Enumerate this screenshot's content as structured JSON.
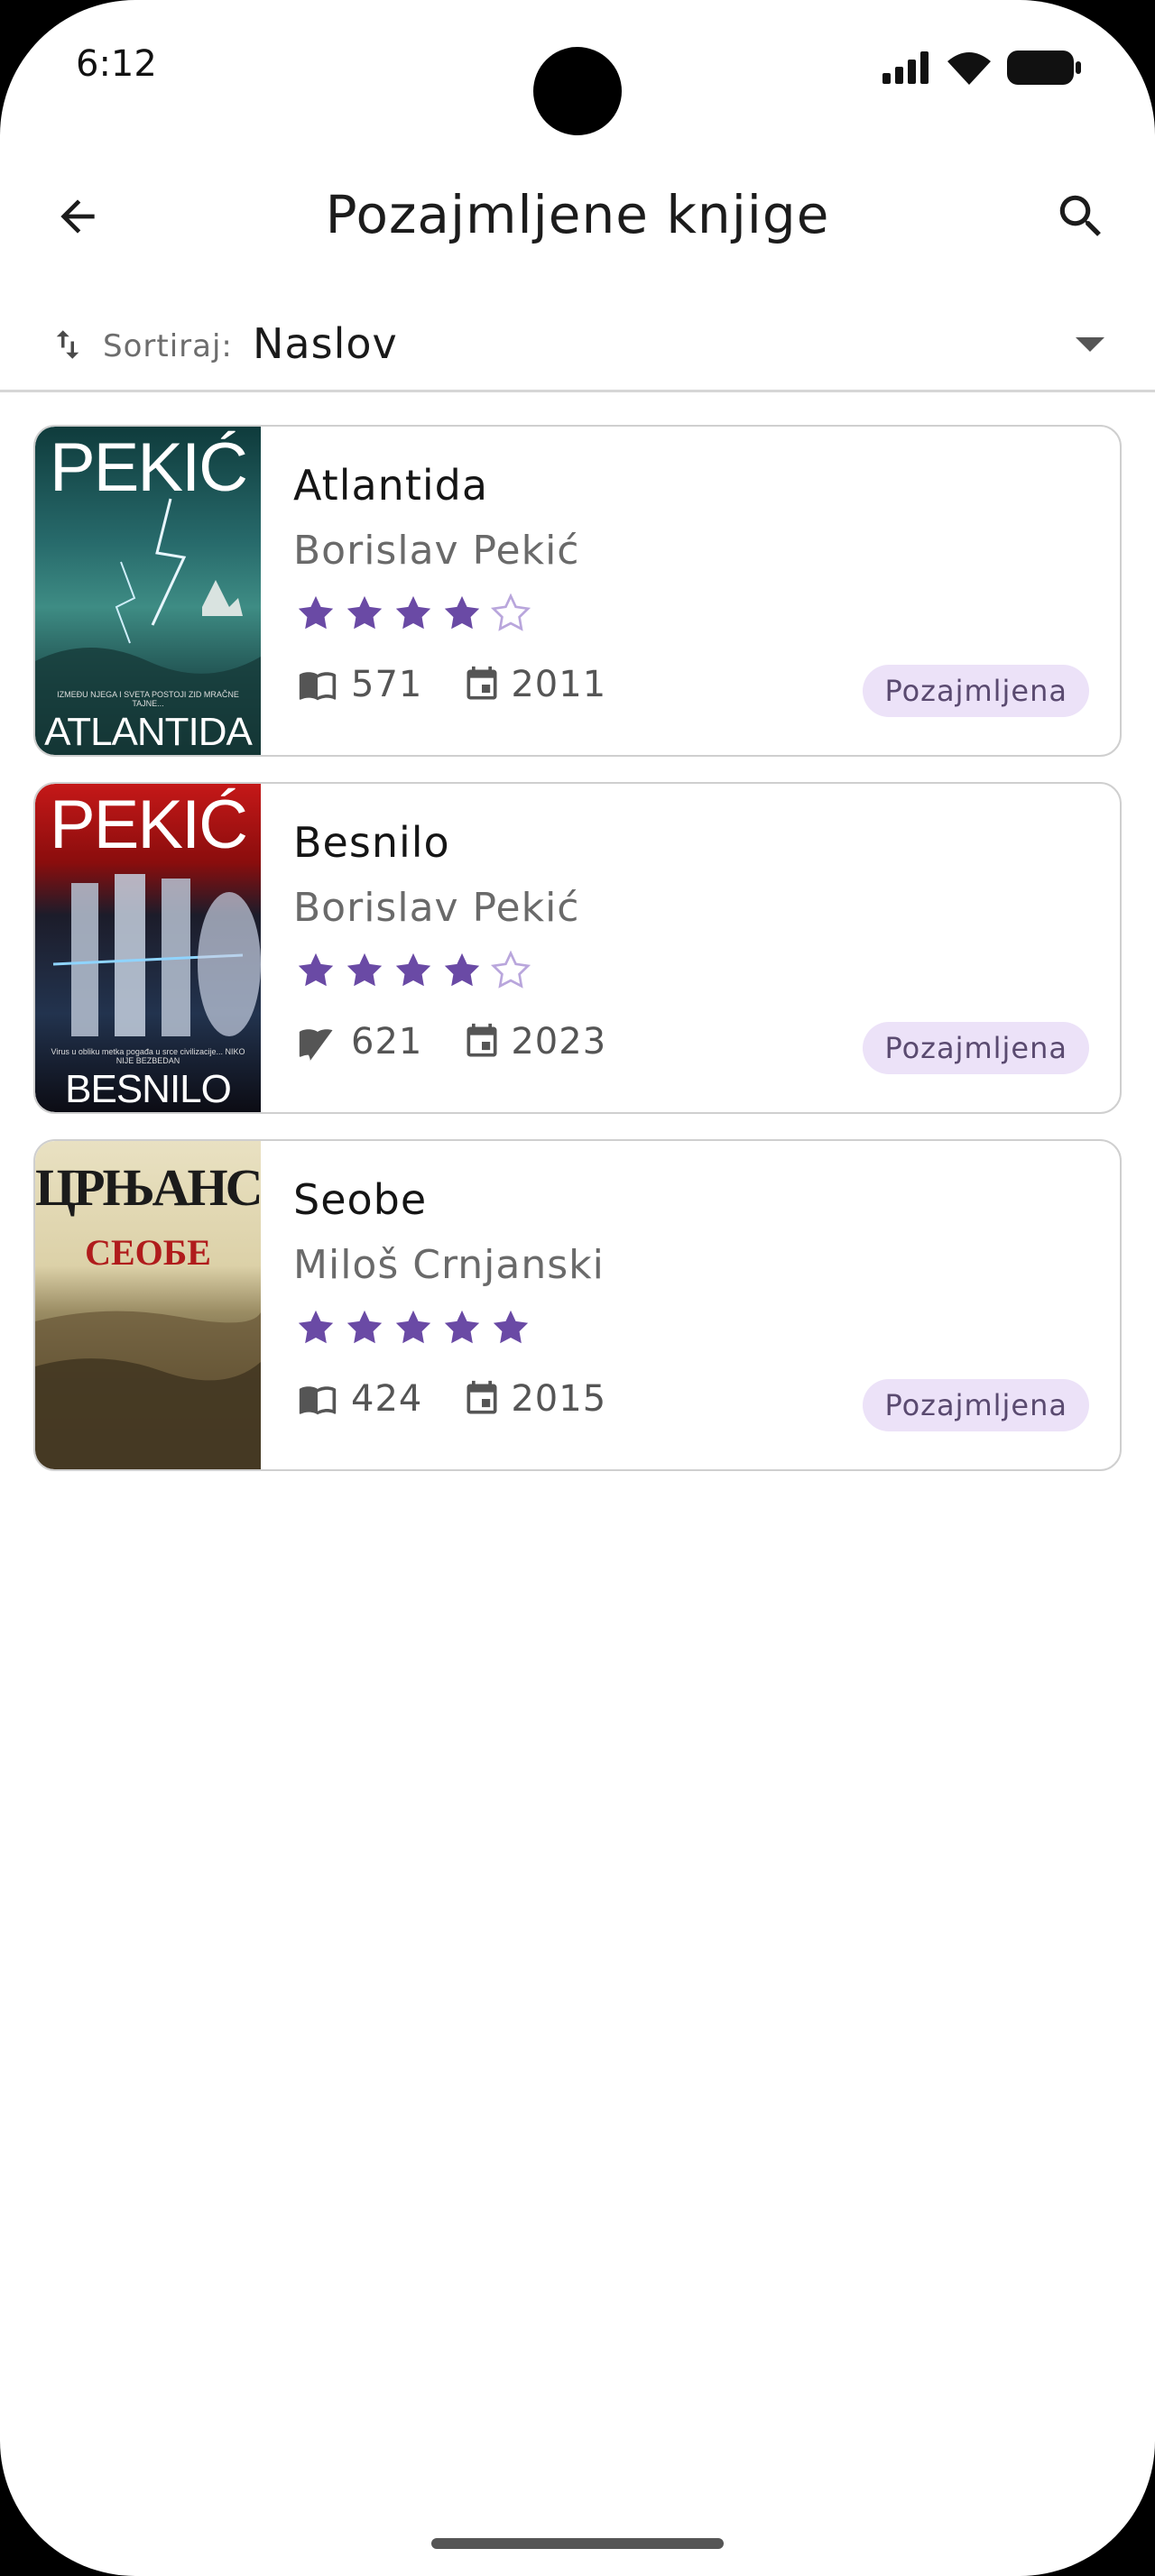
{
  "status_bar": {
    "time": "6:12"
  },
  "app_bar": {
    "title": "Pozajmljene knjige"
  },
  "sort": {
    "label": "Sortiraj:",
    "value": "Naslov"
  },
  "books": [
    {
      "title": "Atlantida",
      "author": "Borislav Pekić",
      "rating": 4,
      "max_rating": 5,
      "pages": "571",
      "year": "2011",
      "status": "Pozajmljena",
      "cover": {
        "top_text": "PEKIĆ",
        "bottom_text": "ATLANTIDA",
        "tagline": "IZMEĐU NJEGA I SVETA POSTOJI ZID MRAČNE TAJNE..."
      }
    },
    {
      "title": "Besnilo",
      "author": "Borislav Pekić",
      "rating": 4,
      "max_rating": 5,
      "pages": "621",
      "year": "2023",
      "status": "Pozajmljena",
      "cover": {
        "top_text": "PEKIĆ",
        "bottom_text": "BESNILO",
        "tagline": "Virus u obliku metka pogađa u srce civilizacije... NIKO NIJE BEZBEDAN"
      }
    },
    {
      "title": "Seobe",
      "author": "Miloš Crnjanski",
      "rating": 5,
      "max_rating": 5,
      "pages": "424",
      "year": "2015",
      "status": "Pozajmljena",
      "cover": {
        "top_text": "ЦРЊАНСКИ",
        "sub_text": "СЕОБЕ"
      }
    }
  ],
  "colors": {
    "star": "#6a4aa5",
    "badge_bg": "#ece2f8",
    "accent": "#6a4aa5"
  }
}
